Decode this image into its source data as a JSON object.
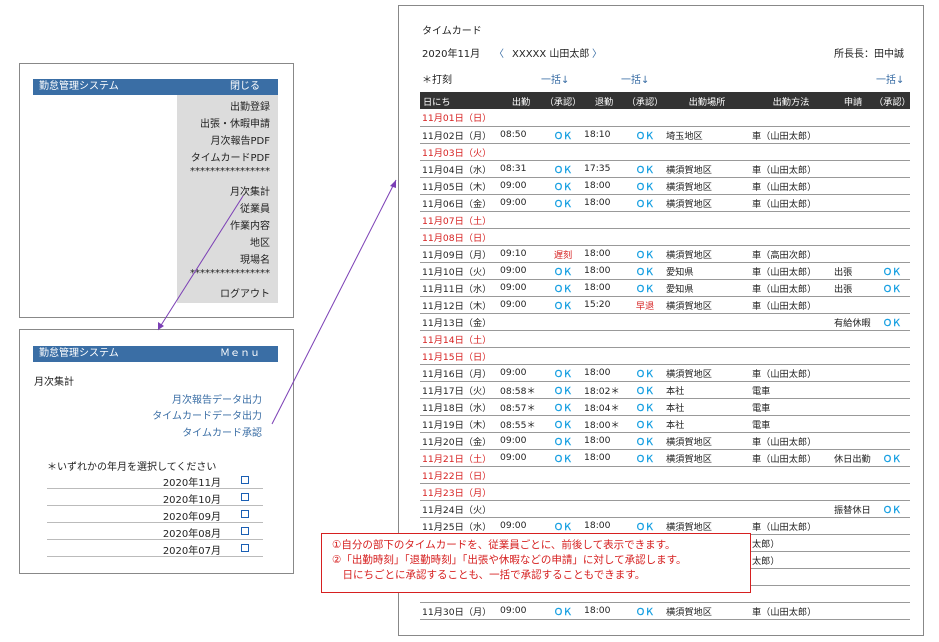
{
  "menu_panel": {
    "title": "勤怠管理システム",
    "close_label": "閉じる",
    "items": [
      "出勤登録",
      "出張・休暇申請",
      "月次報告PDF",
      "タイムカードPDF",
      "****************",
      "月次集計",
      "従業員",
      "作業内容",
      "地区",
      "現場名",
      "****************",
      "ログアウト"
    ]
  },
  "summary_panel": {
    "title": "勤怠管理システム",
    "menu_label": "Ｍｅｎｕ",
    "section_title": "月次集計",
    "links": [
      "月次報告データ出力",
      "タイムカードデータ出力",
      "タイムカード承認"
    ],
    "prompt": "＊いずれかの年月を選択してください",
    "months": [
      "2020年11月",
      "2020年10月",
      "2020年09月",
      "2020年08月",
      "2020年07月"
    ]
  },
  "timecard": {
    "title": "タイムカード",
    "month": "2020年11月",
    "prev": "〈",
    "employee": "XXXXX 山田太郎",
    "next": "〉",
    "manager": "所長長：田中誠",
    "stamp_label": "＊打刻",
    "bulk_label": "一括↓",
    "headers": [
      "日にち",
      "出勤",
      "（承認）",
      "退勤",
      "（承認）",
      "出勤場所",
      "出勤方法",
      "申請",
      "（承認）"
    ],
    "rows": [
      {
        "date": "11月01日（日）",
        "in": "",
        "ina": "",
        "out": "",
        "outa": "",
        "place": "",
        "method": "",
        "req": "",
        "reqa": "",
        "red": true
      },
      {
        "date": "11月02日（月）",
        "in": "08:50",
        "ina": "ＯＫ",
        "out": "18:10",
        "outa": "ＯＫ",
        "place": "埼玉地区",
        "method": "車（山田太郎）",
        "req": "",
        "reqa": ""
      },
      {
        "date": "11月03日（火）",
        "in": "",
        "ina": "",
        "out": "",
        "outa": "",
        "place": "",
        "method": "",
        "req": "",
        "reqa": "",
        "red": true
      },
      {
        "date": "11月04日（水）",
        "in": "08:31",
        "ina": "ＯＫ",
        "out": "17:35",
        "outa": "ＯＫ",
        "place": "横須賀地区",
        "method": "車（山田太郎）",
        "req": "",
        "reqa": ""
      },
      {
        "date": "11月05日（木）",
        "in": "09:00",
        "ina": "ＯＫ",
        "out": "18:00",
        "outa": "ＯＫ",
        "place": "横須賀地区",
        "method": "車（山田太郎）",
        "req": "",
        "reqa": ""
      },
      {
        "date": "11月06日（金）",
        "in": "09:00",
        "ina": "ＯＫ",
        "out": "18:00",
        "outa": "ＯＫ",
        "place": "横須賀地区",
        "method": "車（山田太郎）",
        "req": "",
        "reqa": ""
      },
      {
        "date": "11月07日（土）",
        "in": "",
        "ina": "",
        "out": "",
        "outa": "",
        "place": "",
        "method": "",
        "req": "",
        "reqa": "",
        "red": true
      },
      {
        "date": "11月08日（日）",
        "in": "",
        "ina": "",
        "out": "",
        "outa": "",
        "place": "",
        "method": "",
        "req": "",
        "reqa": "",
        "red": true
      },
      {
        "date": "11月09日（月）",
        "in": "09:10",
        "ina": "遅刻",
        "out": "18:00",
        "outa": "ＯＫ",
        "place": "横須賀地区",
        "method": "車（高田次郎）",
        "req": "",
        "reqa": ""
      },
      {
        "date": "11月10日（火）",
        "in": "09:00",
        "ina": "ＯＫ",
        "out": "18:00",
        "outa": "ＯＫ",
        "place": "愛知県",
        "method": "車（山田太郎）",
        "req": "出張",
        "reqa": "ＯＫ"
      },
      {
        "date": "11月11日（水）",
        "in": "09:00",
        "ina": "ＯＫ",
        "out": "18:00",
        "outa": "ＯＫ",
        "place": "愛知県",
        "method": "車（山田太郎）",
        "req": "出張",
        "reqa": "ＯＫ"
      },
      {
        "date": "11月12日（木）",
        "in": "09:00",
        "ina": "ＯＫ",
        "out": "15:20",
        "outa": "早退",
        "place": "横須賀地区",
        "method": "車（山田太郎）",
        "req": "",
        "reqa": ""
      },
      {
        "date": "11月13日（金）",
        "in": "",
        "ina": "",
        "out": "",
        "outa": "",
        "place": "",
        "method": "",
        "req": "有給休暇",
        "reqa": "ＯＫ"
      },
      {
        "date": "11月14日（土）",
        "in": "",
        "ina": "",
        "out": "",
        "outa": "",
        "place": "",
        "method": "",
        "req": "",
        "reqa": "",
        "red": true
      },
      {
        "date": "11月15日（日）",
        "in": "",
        "ina": "",
        "out": "",
        "outa": "",
        "place": "",
        "method": "",
        "req": "",
        "reqa": "",
        "red": true
      },
      {
        "date": "11月16日（月）",
        "in": "09:00",
        "ina": "ＯＫ",
        "out": "18:00",
        "outa": "ＯＫ",
        "place": "横須賀地区",
        "method": "車（山田太郎）",
        "req": "",
        "reqa": ""
      },
      {
        "date": "11月17日（火）",
        "in": "08:58＊",
        "ina": "ＯＫ",
        "out": "18:02＊",
        "outa": "ＯＫ",
        "place": "本社",
        "method": "電車",
        "req": "",
        "reqa": ""
      },
      {
        "date": "11月18日（水）",
        "in": "08:57＊",
        "ina": "ＯＫ",
        "out": "18:04＊",
        "outa": "ＯＫ",
        "place": "本社",
        "method": "電車",
        "req": "",
        "reqa": ""
      },
      {
        "date": "11月19日（木）",
        "in": "08:55＊",
        "ina": "ＯＫ",
        "out": "18:00＊",
        "outa": "ＯＫ",
        "place": "本社",
        "method": "電車",
        "req": "",
        "reqa": ""
      },
      {
        "date": "11月20日（金）",
        "in": "09:00",
        "ina": "ＯＫ",
        "out": "18:00",
        "outa": "ＯＫ",
        "place": "横須賀地区",
        "method": "車（山田太郎）",
        "req": "",
        "reqa": ""
      },
      {
        "date": "11月21日（土）",
        "in": "09:00",
        "ina": "ＯＫ",
        "out": "18:00",
        "outa": "ＯＫ",
        "place": "横須賀地区",
        "method": "車（山田太郎）",
        "req": "休日出勤",
        "reqa": "ＯＫ",
        "red": true
      },
      {
        "date": "11月22日（日）",
        "in": "",
        "ina": "",
        "out": "",
        "outa": "",
        "place": "",
        "method": "",
        "req": "",
        "reqa": "",
        "red": true
      },
      {
        "date": "11月23日（月）",
        "in": "",
        "ina": "",
        "out": "",
        "outa": "",
        "place": "",
        "method": "",
        "req": "",
        "reqa": "",
        "red": true
      },
      {
        "date": "11月24日（火）",
        "in": "",
        "ina": "",
        "out": "",
        "outa": "",
        "place": "",
        "method": "",
        "req": "振替休日",
        "reqa": "ＯＫ"
      },
      {
        "date": "11月25日（水）",
        "in": "09:00",
        "ina": "ＯＫ",
        "out": "18:00",
        "outa": "ＯＫ",
        "place": "横須賀地区",
        "method": "車（山田太郎）",
        "req": "",
        "reqa": ""
      },
      {
        "date": "",
        "in": "",
        "ina": "",
        "out": "",
        "outa": "",
        "place": "",
        "method": "太郎）",
        "req": "",
        "reqa": ""
      },
      {
        "date": "",
        "in": "",
        "ina": "",
        "out": "",
        "outa": "",
        "place": "",
        "method": "太郎）",
        "req": "",
        "reqa": ""
      },
      {
        "date": "",
        "in": "",
        "ina": "",
        "out": "",
        "outa": "",
        "place": "",
        "method": "",
        "req": "",
        "reqa": ""
      },
      {
        "date": "",
        "in": "",
        "ina": "",
        "out": "",
        "outa": "",
        "place": "",
        "method": "",
        "req": "",
        "reqa": ""
      },
      {
        "date": "11月30日（月）",
        "in": "09:00",
        "ina": "ＯＫ",
        "out": "18:00",
        "outa": "ＯＫ",
        "place": "横須賀地区",
        "method": "車（山田太郎）",
        "req": "",
        "reqa": ""
      }
    ]
  },
  "note": {
    "lines": [
      "①自分の部下のタイムカードを、従業員ごとに、前後して表示できます。",
      "②「出勤時刻」「退勤時刻」「出張や休暇などの申請」に対して承認します。",
      "　日にちごとに承認することも、一括で承認することもできます。"
    ]
  },
  "colors": {
    "header_blue": "#3a6ea5",
    "ok_blue": "#1ba1e2",
    "red": "#d62020"
  }
}
